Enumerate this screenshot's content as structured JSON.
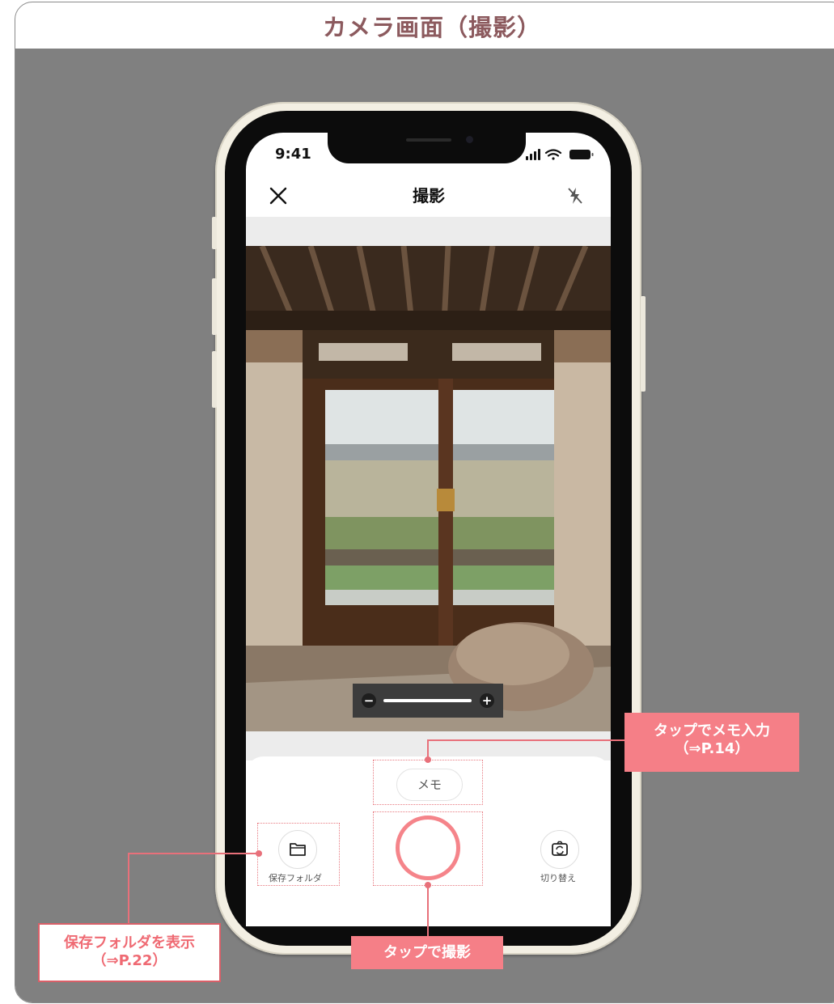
{
  "page": {
    "title": "カメラ画面（撮影）"
  },
  "device": {
    "time": "9:41"
  },
  "nav": {
    "title": "撮影",
    "close_icon": "close-icon",
    "flash_icon": "flash-off-icon"
  },
  "camera": {
    "zoom_minus": "−",
    "zoom_plus": "+",
    "memo_label": "メモ",
    "folder_label": "保存フォルダ",
    "switch_label": "切り替え"
  },
  "callouts": {
    "memo": {
      "line1": "タップでメモ入力",
      "line2": "（⇒P.14）"
    },
    "shutter": {
      "line1": "タップで撮影"
    },
    "folder": {
      "line1": "保存フォルダを表示",
      "line2": "（⇒P.22）"
    }
  },
  "colors": {
    "accent": "#f57f87",
    "title": "#8c5a5e",
    "background": "#808080"
  }
}
